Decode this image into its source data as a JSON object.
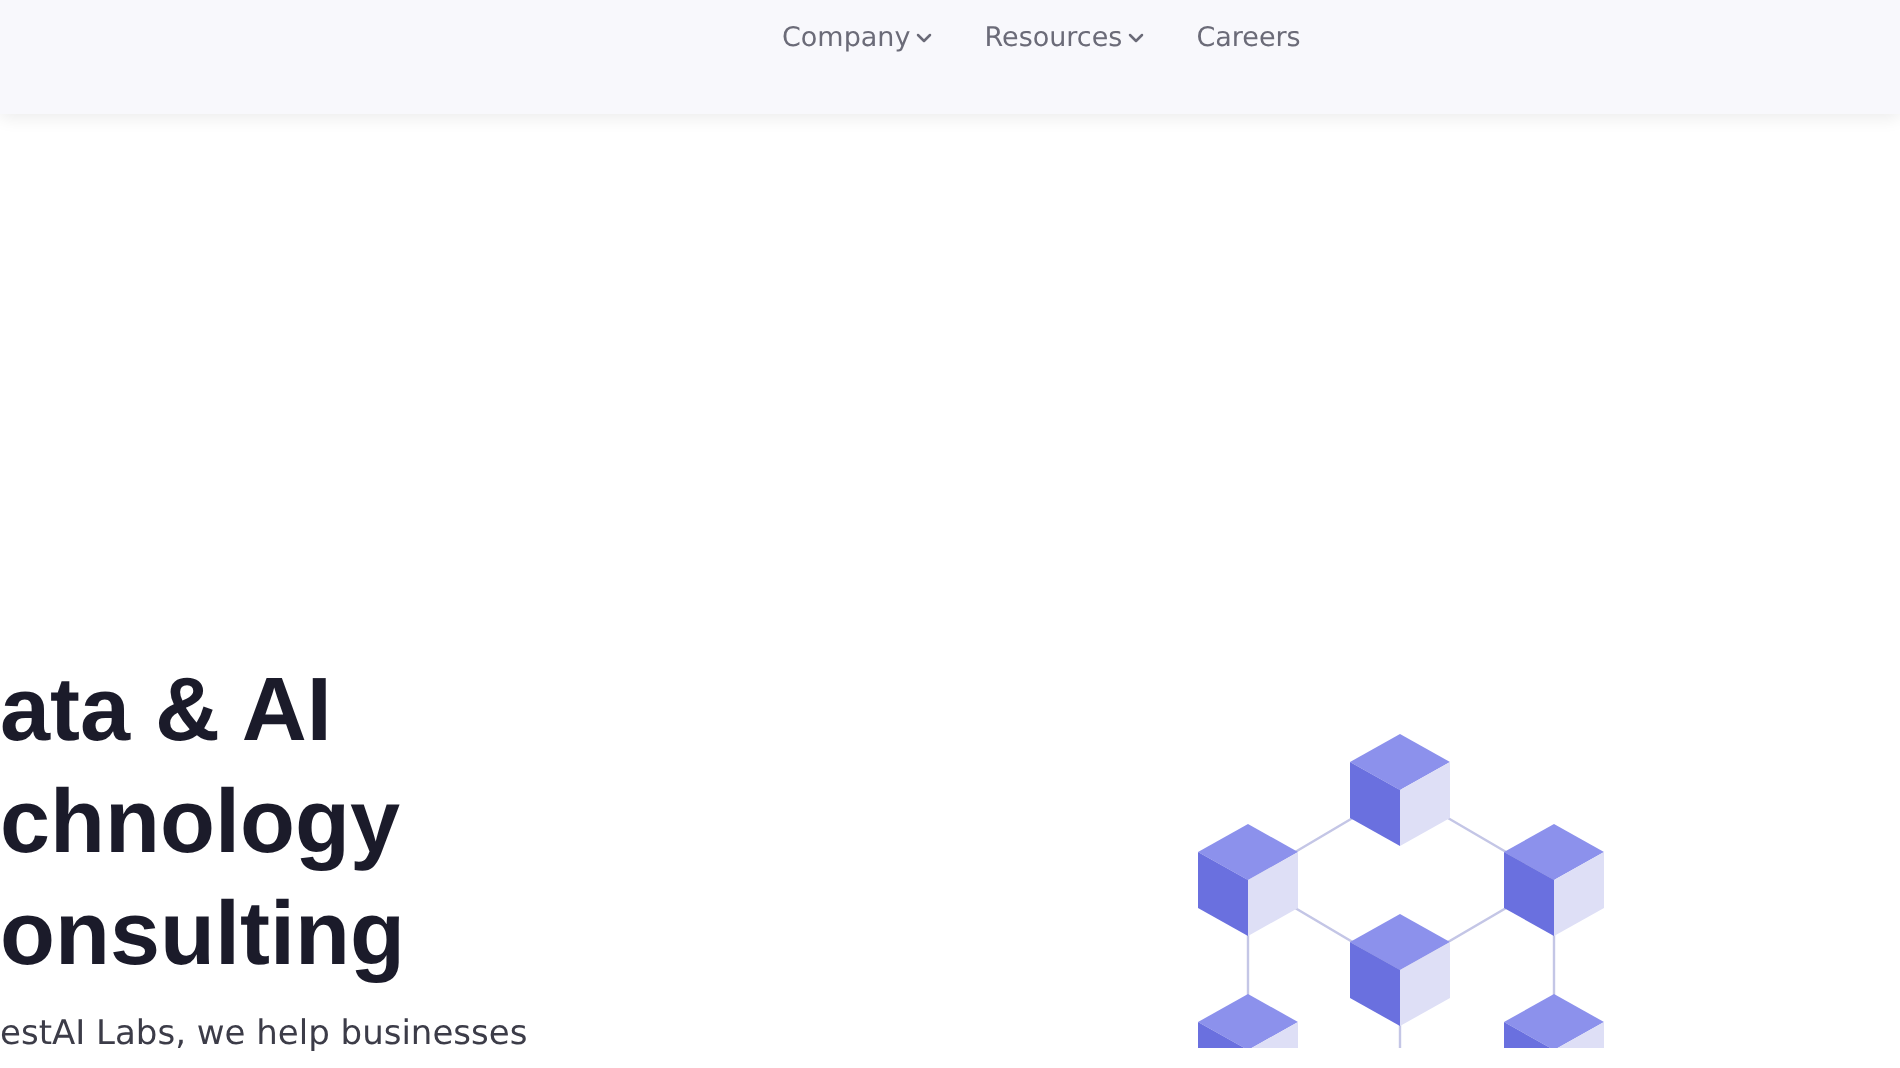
{
  "nav": {
    "items": [
      {
        "label": "Company",
        "has_menu": true
      },
      {
        "label": "Resources",
        "has_menu": true
      },
      {
        "label": "Careers",
        "has_menu": false
      }
    ]
  },
  "hero": {
    "heading_lines": [
      "ata & AI",
      "chnology",
      "onsulting"
    ],
    "intro": "estAI Labs, we help businesses"
  }
}
